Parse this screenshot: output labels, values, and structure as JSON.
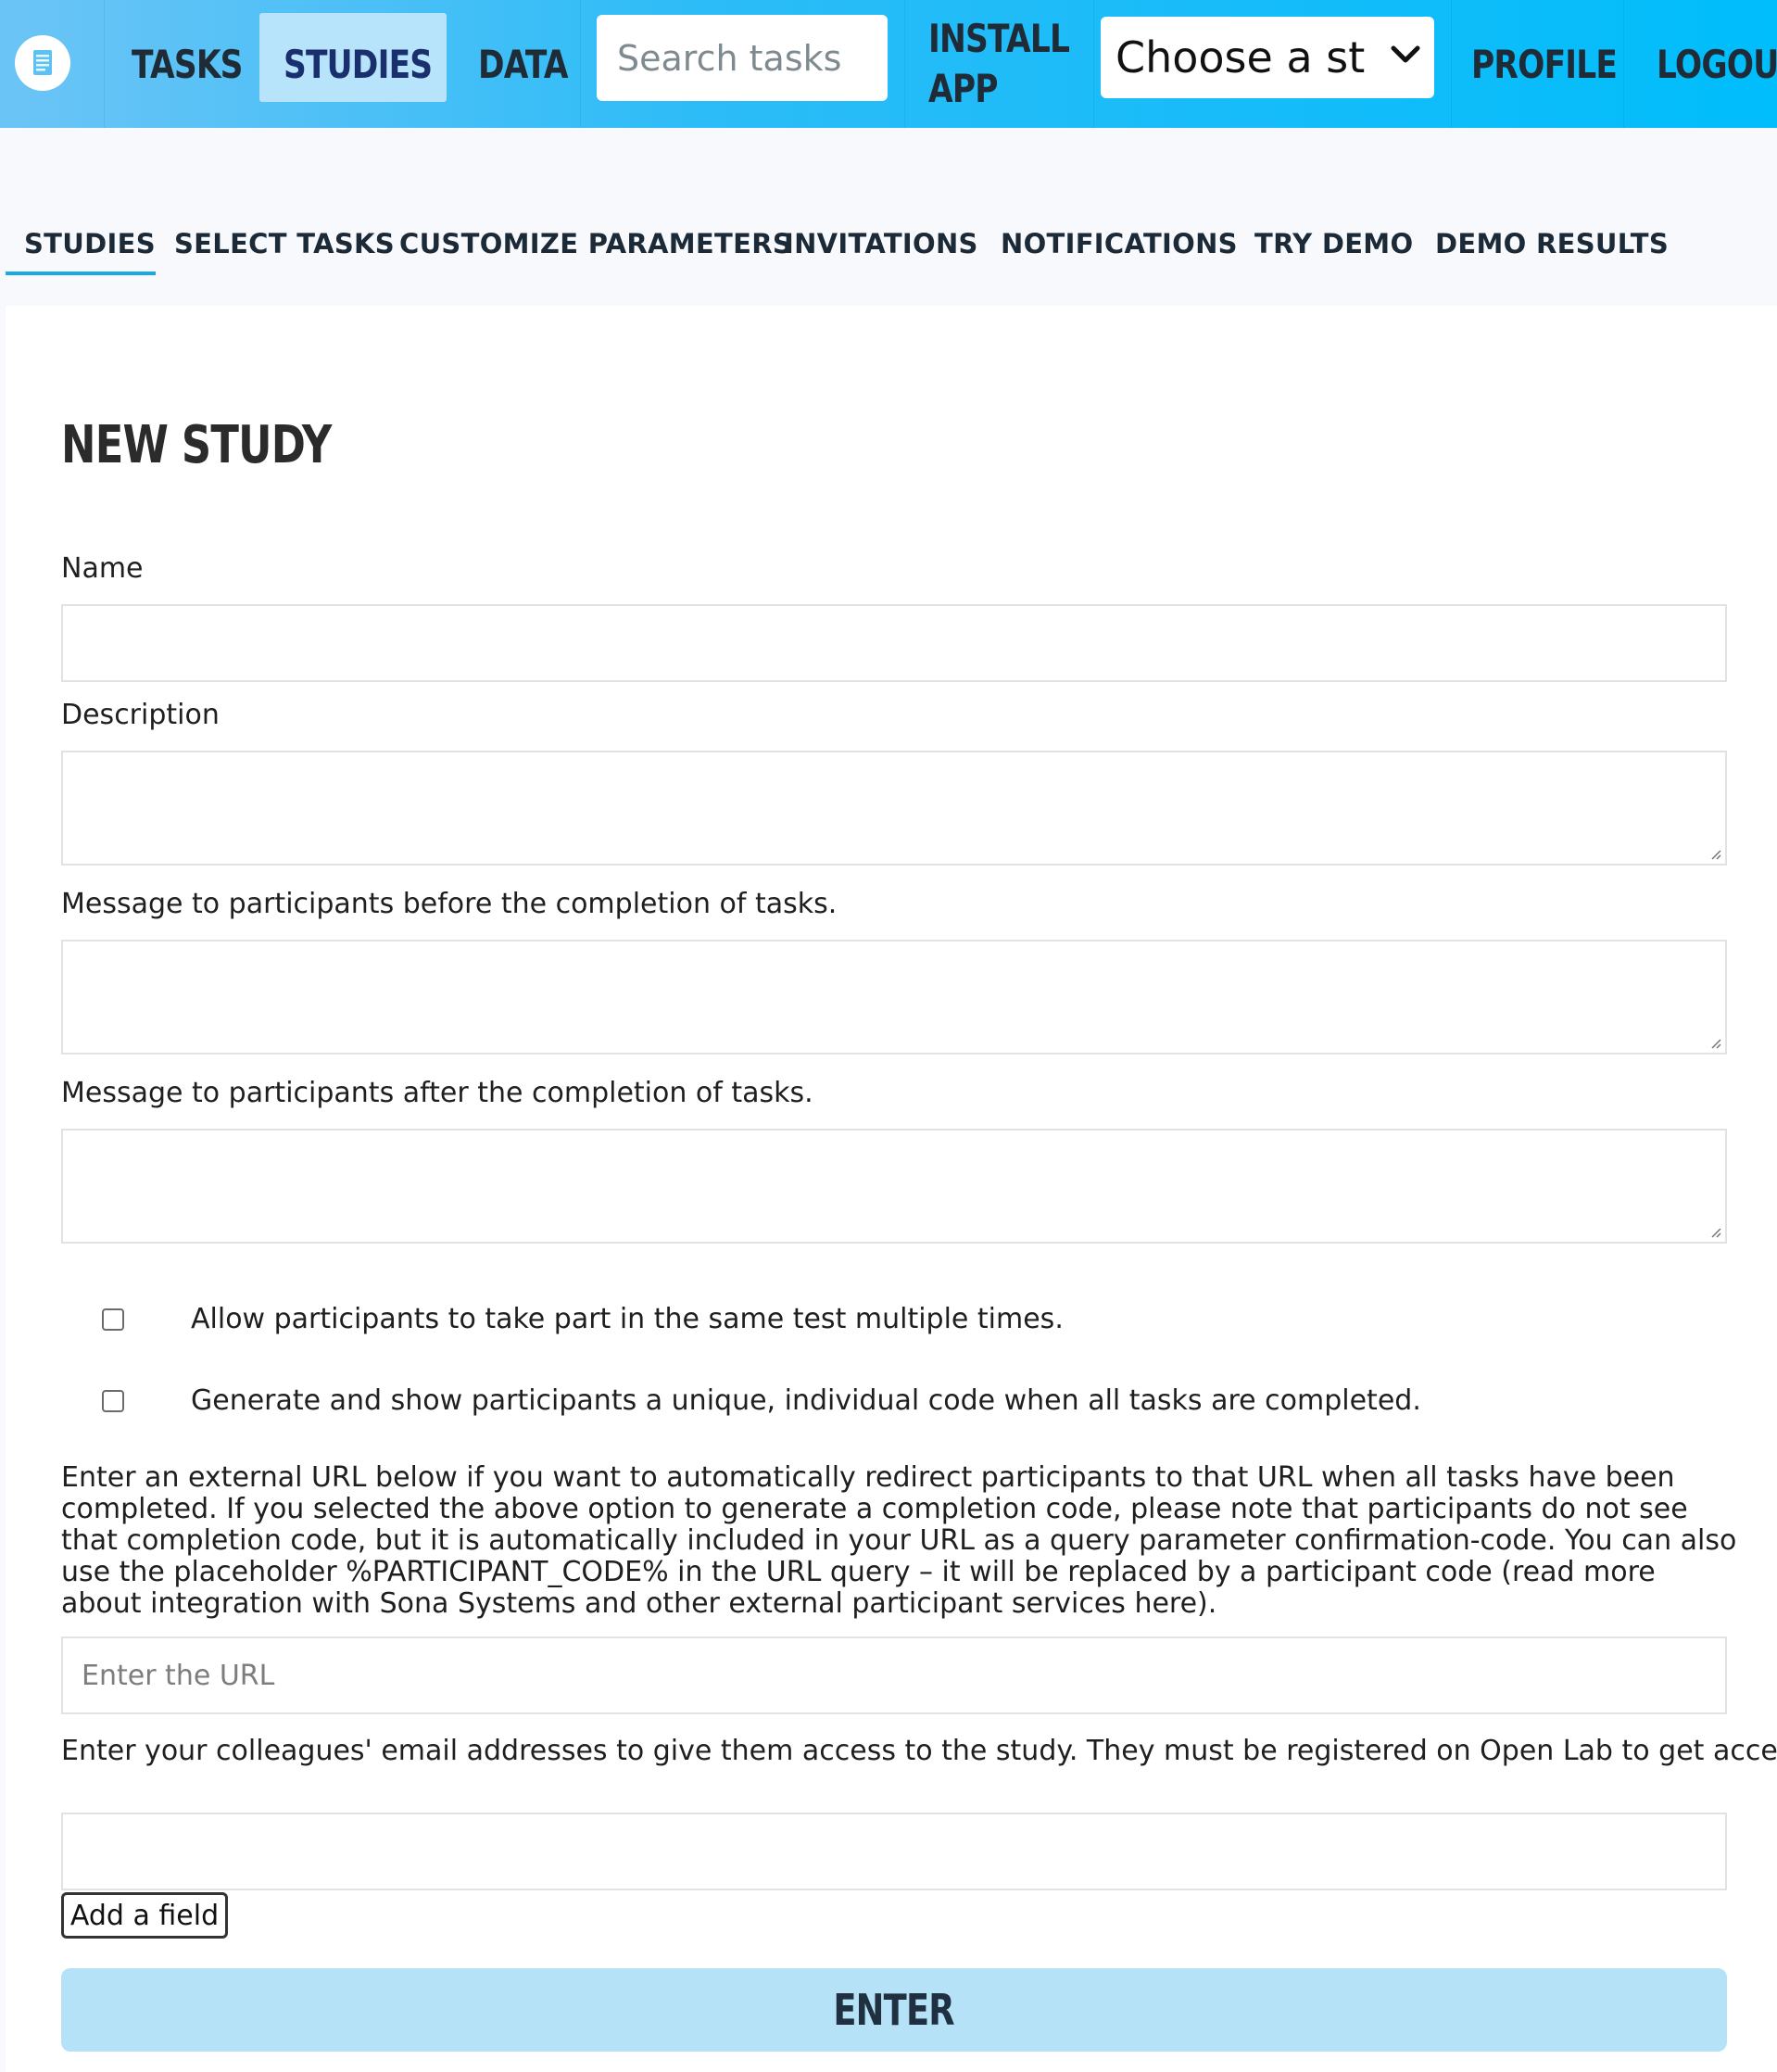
{
  "nav": {
    "tasks": "TASKS",
    "studies": "STUDIES",
    "data": "DATA",
    "search_placeholder": "Search tasks",
    "install_line1": "INSTALL",
    "install_line2": "APP",
    "study_select": "Choose a st",
    "profile": "PROFILE",
    "logout": "LOGOUT"
  },
  "tabs": {
    "studies": "STUDIES",
    "select_tasks": "SELECT TASKS",
    "customize": "CUSTOMIZE PARAMETERS",
    "invitations": "INVITATIONS",
    "notifications": "NOTIFICATIONS",
    "try_demo": "TRY DEMO",
    "demo_results": "DEMO RESULTS"
  },
  "form": {
    "title": "NEW STUDY",
    "name_label": "Name",
    "description_label": "Description",
    "before_label": "Message to participants before the completion of tasks.",
    "after_label": "Message to participants after the completion of tasks.",
    "multiple_label": "Allow participants to take part in the same test multiple times.",
    "code_label": "Generate and show participants a unique, individual code when all tasks are completed.",
    "redirect_text_1": "Enter an external URL below if you want to automatically redirect participants to that URL when all tasks have been completed. If you selected the above option to generate a completion code, please note that participants do not see that completion code, but it is automatically included in your URL as a query parameter ",
    "redirect_param": "confirmation-code",
    "redirect_text_2": ". You can also use the placeholder %PARTICIPANT_CODE% in the URL query – it will be replaced by a participant code (read more about integration with Sona Systems and other external participant services here).",
    "url_placeholder": "Enter the URL",
    "colleagues_text": "Enter your colleagues' email addresses to give them access to the study. They must be registered on Open Lab to get access.",
    "add_field": "Add a field",
    "enter": "ENTER"
  },
  "colors": {
    "topbar": "#00bdfb",
    "active_tab": "#b7e3fb",
    "enter_button": "#b6e2f8",
    "tab_underline": "#1ba9e6"
  }
}
